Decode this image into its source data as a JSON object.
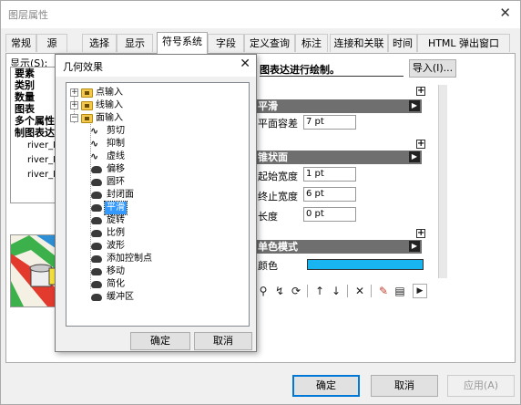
{
  "window": {
    "title": "图层属性"
  },
  "tabs": [
    "常规",
    "源",
    "选择",
    "显示",
    "符号系统",
    "字段",
    "定义查询",
    "标注",
    "连接和关联",
    "时间",
    "HTML 弹出窗口"
  ],
  "active_tab": "符号系统",
  "show": {
    "label": "显示(S):",
    "items": [
      "要素",
      "类别",
      "数量",
      "图表",
      "多个属性",
      "制图表达"
    ],
    "sub_items": [
      "river_Re",
      "river_Re",
      "river_Re"
    ]
  },
  "description": "图表达进行绘制。",
  "import_button": "导入(I)...",
  "props": {
    "groups": [
      {
        "name": "平滑",
        "fields": [
          {
            "label": "平面容差",
            "value": "7 pt"
          }
        ]
      },
      {
        "name": "锥状面",
        "fields": [
          {
            "label": "起始宽度",
            "value": "1 pt"
          },
          {
            "label": "终止宽度",
            "value": "6 pt"
          },
          {
            "label": "长度",
            "value": "0 pt"
          }
        ]
      },
      {
        "name": "单色模式",
        "fields": [
          {
            "label": "颜色"
          }
        ]
      }
    ],
    "color_value": "#19b5f0"
  },
  "footer": {
    "ok": "确定",
    "cancel": "取消",
    "apply": "应用(A)"
  },
  "dialog": {
    "title": "几何效果",
    "tree": {
      "categories": [
        "点输入",
        "线输入",
        "面输入"
      ],
      "effects": [
        {
          "label": "剪切",
          "icon": "line-effect-icon"
        },
        {
          "label": "抑制",
          "icon": "line-effect-icon"
        },
        {
          "label": "虚线",
          "icon": "line-effect-icon"
        },
        {
          "label": "偏移",
          "icon": "polygon-effect-icon"
        },
        {
          "label": "圆环",
          "icon": "polygon-effect-icon"
        },
        {
          "label": "封闭面",
          "icon": "polygon-effect-icon"
        },
        {
          "label": "平滑",
          "icon": "polygon-effect-icon"
        },
        {
          "label": "旋转",
          "icon": "polygon-effect-icon"
        },
        {
          "label": "比例",
          "icon": "polygon-effect-icon"
        },
        {
          "label": "波形",
          "icon": "polygon-effect-icon"
        },
        {
          "label": "添加控制点",
          "icon": "polygon-effect-icon"
        },
        {
          "label": "移动",
          "icon": "polygon-effect-icon"
        },
        {
          "label": "简化",
          "icon": "polygon-effect-icon"
        },
        {
          "label": "缓冲区",
          "icon": "polygon-effect-icon"
        }
      ],
      "selected": "平滑"
    },
    "ok": "确定",
    "cancel": "取消"
  }
}
